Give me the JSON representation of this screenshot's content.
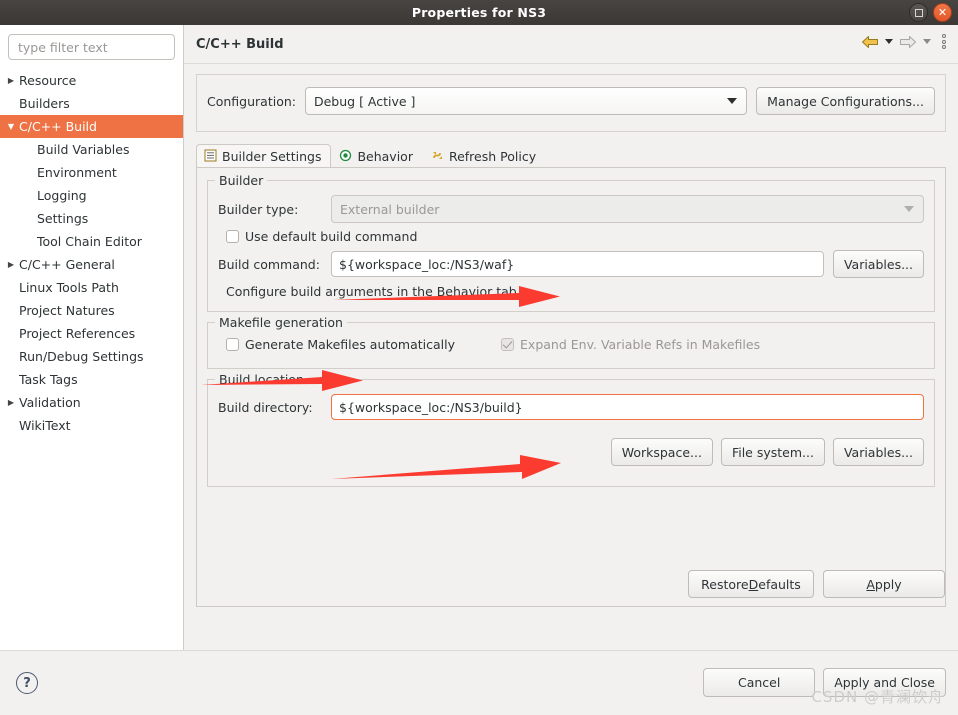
{
  "window": {
    "title": "Properties for NS3",
    "buttons": {
      "maximize": "maximize-icon",
      "close": "close-icon"
    }
  },
  "sidebar": {
    "filter": {
      "placeholder": "type filter text",
      "value": ""
    },
    "items": [
      {
        "label": "Resource",
        "level": 1,
        "twisty": "collapsed",
        "selected": false
      },
      {
        "label": "Builders",
        "level": 1,
        "twisty": "none",
        "selected": false
      },
      {
        "label": "C/C++ Build",
        "level": 1,
        "twisty": "expanded",
        "selected": true
      },
      {
        "label": "Build Variables",
        "level": 2,
        "twisty": "none",
        "selected": false
      },
      {
        "label": "Environment",
        "level": 2,
        "twisty": "none",
        "selected": false
      },
      {
        "label": "Logging",
        "level": 2,
        "twisty": "none",
        "selected": false
      },
      {
        "label": "Settings",
        "level": 2,
        "twisty": "none",
        "selected": false
      },
      {
        "label": "Tool Chain Editor",
        "level": 2,
        "twisty": "none",
        "selected": false
      },
      {
        "label": "C/C++ General",
        "level": 1,
        "twisty": "collapsed",
        "selected": false
      },
      {
        "label": "Linux Tools Path",
        "level": 1,
        "twisty": "none",
        "selected": false
      },
      {
        "label": "Project Natures",
        "level": 1,
        "twisty": "none",
        "selected": false
      },
      {
        "label": "Project References",
        "level": 1,
        "twisty": "none",
        "selected": false
      },
      {
        "label": "Run/Debug Settings",
        "level": 1,
        "twisty": "none",
        "selected": false
      },
      {
        "label": "Task Tags",
        "level": 1,
        "twisty": "none",
        "selected": false
      },
      {
        "label": "Validation",
        "level": 1,
        "twisty": "collapsed",
        "selected": false
      },
      {
        "label": "WikiText",
        "level": 1,
        "twisty": "none",
        "selected": false
      }
    ]
  },
  "page": {
    "title": "C/C++ Build",
    "nav": {
      "back": "back-arrow-icon",
      "back_menu": "back-history-dropdown-icon",
      "forward": "forward-arrow-icon",
      "forward_menu": "forward-history-dropdown-icon",
      "menu": "view-menu-icon"
    },
    "configuration": {
      "label": "Configuration:",
      "value": "Debug [ Active ]",
      "manage_button": "Manage Configurations..."
    },
    "tabs": [
      {
        "label": "Builder Settings",
        "icon": "builder-settings-icon",
        "active": true
      },
      {
        "label": "Behavior",
        "icon": "behavior-icon",
        "active": false
      },
      {
        "label": "Refresh Policy",
        "icon": "refresh-policy-icon",
        "active": false
      }
    ],
    "builder_group": {
      "title": "Builder",
      "builder_type_label": "Builder type:",
      "builder_type_value": "External builder",
      "builder_type_disabled": true,
      "use_default_label": "Use default build command",
      "use_default_checked": false,
      "build_command_label": "Build command:",
      "build_command_value": "${workspace_loc:/NS3/waf}",
      "variables_button": "Variables...",
      "hint": "Configure build arguments in the Behavior tab."
    },
    "makefile_group": {
      "title": "Makefile generation",
      "generate_label": "Generate Makefiles automatically",
      "generate_checked": false,
      "expand_label": "Expand Env. Variable Refs in Makefiles",
      "expand_checked": true,
      "expand_disabled": true
    },
    "build_location_group": {
      "title": "Build location",
      "build_dir_label": "Build directory:",
      "build_dir_value": "${workspace_loc:/NS3/build}",
      "workspace_button": "Workspace...",
      "filesystem_button": "File system...",
      "variables_button": "Variables..."
    },
    "page_actions": {
      "restore_defaults_pre": "Restore ",
      "restore_defaults_mn": "D",
      "restore_defaults_post": "efaults",
      "apply_mn": "A",
      "apply_post": "pply"
    }
  },
  "footer": {
    "help": "help-icon",
    "cancel_button": "Cancel",
    "apply_close_button": "Apply and Close"
  },
  "watermark": "CSDN @青澜饮舟",
  "colors": {
    "accent": "#ef7245",
    "titlebar": "#3c3835",
    "selection": "#ef7245",
    "annotation_arrow": "#fb3b30",
    "dialog_bg": "#f2f1f0"
  }
}
